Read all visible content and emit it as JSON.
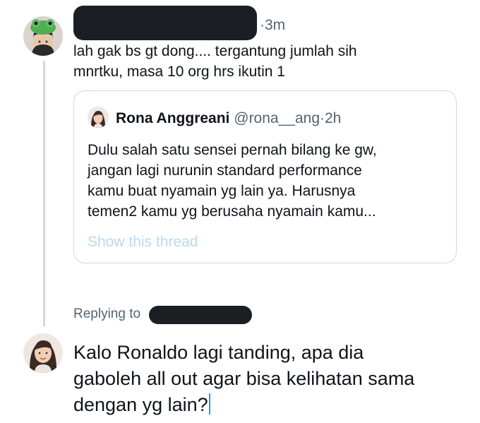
{
  "parent_tweet": {
    "time": "3m",
    "separator": "·",
    "text_line1": "lah gak bs gt dong.... tergantung jumlah sih",
    "text_line2": "mnrtku, masa 10 org hrs ikutin 1"
  },
  "quoted_tweet": {
    "display_name": "Rona Anggreani",
    "handle": "@rona__ang",
    "separator": "·",
    "time": "2h",
    "lines": [
      "Dulu salah satu sensei pernah bilang ke gw,",
      "jangan lagi nurunin standard performance",
      "kamu buat nyamain yg lain ya. Harusnya",
      "temen2 kamu yg berusaha nyamain kamu..."
    ],
    "show_thread_label": "Show this thread"
  },
  "reply": {
    "replying_to_label": "Replying to",
    "lines": [
      "Kalo Ronaldo lagi tanding, apa dia",
      "gaboleh all out agar bisa kelihatan sama",
      "dengan yg lain?"
    ]
  },
  "colors": {
    "link_faded": "#b8d9f2",
    "caret": "#1d9bf0",
    "secondary_text": "#536471",
    "border": "#cfd9de",
    "redaction": "#1b1f23"
  }
}
